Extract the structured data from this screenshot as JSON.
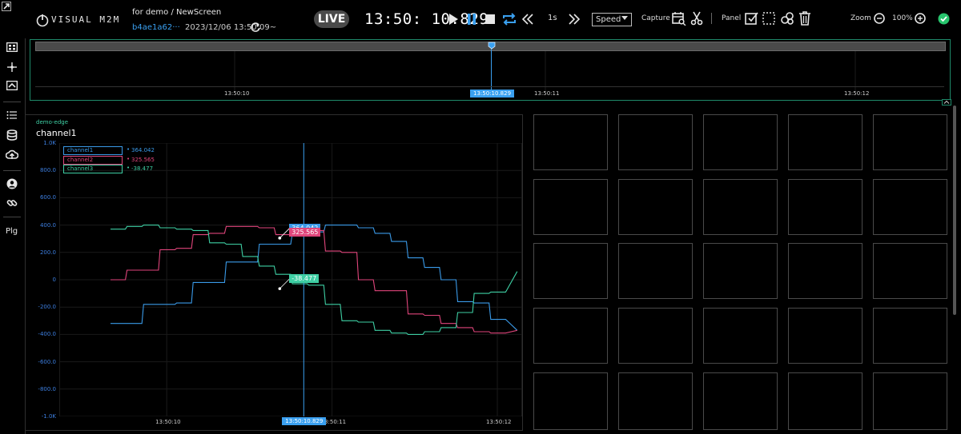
{
  "app": {
    "logo_text": "VISUAL M2M"
  },
  "header": {
    "breadcrumb": "for demo / NewScreen",
    "session_id": "b4ae1a62···",
    "session_time": "2023/12/06 13:50:09~",
    "live_label": "LIVE",
    "clock": "13:50: 10.829",
    "step": "1s",
    "speed_select": "Speed",
    "capture_label": "Capture",
    "panel_label": "Panel",
    "zoom_label": "Zoom",
    "zoom_value": "100%"
  },
  "sidebar": {
    "plg_label": "Plg"
  },
  "timeline": {
    "ticks": [
      "13:50:10",
      "13:50:11",
      "13:50:12"
    ],
    "cursor_label": "13:50:10.829"
  },
  "panel": {
    "subtitle": "demo-edge",
    "title": "channel1",
    "cursor_label": "13:50:10.829"
  },
  "chart_data": {
    "type": "line",
    "title": "channel1",
    "subtitle": "demo-edge",
    "ylim": [
      -1000,
      1000
    ],
    "y_ticks": [
      "1.0K",
      "800.0",
      "600.0",
      "400.0",
      "200.0",
      "0",
      "-200.0",
      "-400.0",
      "-600.0",
      "-800.0",
      "-1.0K"
    ],
    "x_ticks": [
      "13:50:10",
      "13:50:11",
      "13:50:12"
    ],
    "x_tick_values": [
      10.0,
      11.0,
      12.0
    ],
    "xlim": [
      9.35,
      12.15
    ],
    "cursor_x": 10.829,
    "grid": true,
    "legend_position": "top-left",
    "series": [
      {
        "name": "channel1",
        "color": "#3a9ae8",
        "current": "364.042",
        "x": [
          9.66,
          9.75,
          9.76,
          9.85,
          9.86,
          9.95,
          9.96,
          10.05,
          10.06,
          10.15,
          10.16,
          10.25,
          10.26,
          10.35,
          10.36,
          10.45,
          10.46,
          10.55,
          10.56,
          10.65,
          10.66,
          10.75,
          10.76,
          10.85,
          10.86,
          10.95,
          10.96,
          11.05,
          11.06,
          11.15,
          11.16,
          11.25,
          11.26,
          11.35,
          11.36,
          11.45,
          11.46,
          11.55,
          11.56,
          11.65,
          11.66,
          11.75,
          11.76,
          11.85,
          11.86,
          11.95,
          11.96,
          12.05,
          12.12
        ],
        "y": [
          -320,
          -320,
          -320,
          -320,
          -180,
          -180,
          -180,
          -180,
          -170,
          -170,
          -20,
          -20,
          -20,
          -20,
          130,
          130,
          130,
          130,
          260,
          260,
          260,
          260,
          340,
          340,
          350,
          350,
          400,
          400,
          400,
          400,
          380,
          380,
          340,
          340,
          280,
          280,
          160,
          160,
          90,
          90,
          0,
          0,
          -160,
          -160,
          -170,
          -170,
          -290,
          -290,
          -370
        ]
      },
      {
        "name": "channel2",
        "color": "#e0457b",
        "current": "325.565",
        "x": [
          9.66,
          9.75,
          9.76,
          9.85,
          9.86,
          9.95,
          9.96,
          10.05,
          10.06,
          10.15,
          10.16,
          10.25,
          10.26,
          10.35,
          10.36,
          10.45,
          10.46,
          10.55,
          10.56,
          10.65,
          10.66,
          10.75,
          10.76,
          10.85,
          10.86,
          10.95,
          10.96,
          11.05,
          11.06,
          11.15,
          11.16,
          11.25,
          11.26,
          11.35,
          11.36,
          11.45,
          11.46,
          11.55,
          11.56,
          11.65,
          11.66,
          11.75,
          11.76,
          11.85,
          11.86,
          11.95,
          11.96,
          12.05,
          12.12
        ],
        "y": [
          0,
          0,
          70,
          70,
          70,
          70,
          220,
          220,
          230,
          230,
          330,
          330,
          340,
          340,
          390,
          390,
          390,
          390,
          380,
          380,
          330,
          330,
          340,
          340,
          360,
          360,
          210,
          210,
          200,
          200,
          0,
          0,
          -80,
          -80,
          -80,
          -80,
          -250,
          -250,
          -260,
          -260,
          -320,
          -320,
          -350,
          -350,
          -380,
          -380,
          -390,
          -390,
          -370
        ]
      },
      {
        "name": "channel3",
        "color": "#3ecfa4",
        "current": "-38.477",
        "x": [
          9.66,
          9.75,
          9.76,
          9.85,
          9.86,
          9.95,
          9.96,
          10.05,
          10.06,
          10.15,
          10.16,
          10.25,
          10.26,
          10.35,
          10.36,
          10.45,
          10.46,
          10.55,
          10.56,
          10.65,
          10.66,
          10.75,
          10.76,
          10.85,
          10.86,
          10.95,
          10.96,
          11.05,
          11.06,
          11.15,
          11.16,
          11.25,
          11.26,
          11.35,
          11.36,
          11.45,
          11.46,
          11.55,
          11.56,
          11.65,
          11.66,
          11.75,
          11.76,
          11.85,
          11.86,
          11.95,
          11.96,
          12.05,
          12.12
        ],
        "y": [
          370,
          370,
          390,
          390,
          400,
          400,
          380,
          380,
          370,
          370,
          360,
          360,
          270,
          270,
          260,
          260,
          170,
          170,
          100,
          100,
          40,
          40,
          -30,
          -30,
          -40,
          -40,
          -180,
          -180,
          -300,
          -300,
          -310,
          -310,
          -370,
          -370,
          -390,
          -390,
          -400,
          -400,
          -380,
          -380,
          -350,
          -350,
          -240,
          -240,
          -100,
          -100,
          -90,
          -90,
          60
        ]
      }
    ]
  },
  "theme": {
    "accent": "#3aa0f0",
    "live_bg": "#4a4a4a",
    "frame_green": "#1f8a6a",
    "status_ok": "#27c46d"
  }
}
